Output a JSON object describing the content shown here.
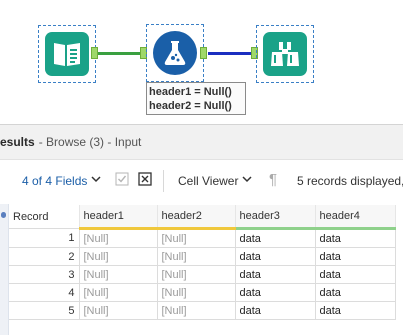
{
  "annotation": {
    "line1": "header1 = Null()",
    "line2": "header2 = Null()"
  },
  "results": {
    "title": "esults",
    "subtitle": "- Browse (3) - Input"
  },
  "toolbar": {
    "fields_label": "4 of 4 Fields",
    "viewer_label": "Cell Viewer",
    "status_text": "5 records displayed,"
  },
  "table": {
    "columns": [
      "Record",
      "header1",
      "header2",
      "header3",
      "header4"
    ],
    "rows": [
      [
        "1",
        "[Null]",
        "[Null]",
        "data",
        "data"
      ],
      [
        "2",
        "[Null]",
        "[Null]",
        "data",
        "data"
      ],
      [
        "3",
        "[Null]",
        "[Null]",
        "data",
        "data"
      ],
      [
        "4",
        "[Null]",
        "[Null]",
        "data",
        "data"
      ],
      [
        "5",
        "[Null]",
        "[Null]",
        "data",
        "data"
      ]
    ]
  },
  "colors": {
    "tool_teal": "#1aa288",
    "formula_blue": "#1a5fa8",
    "link_blue": "#1c5fa8",
    "modified_yellow": "#f0c83c",
    "unchanged_green": "#8fd18b"
  }
}
